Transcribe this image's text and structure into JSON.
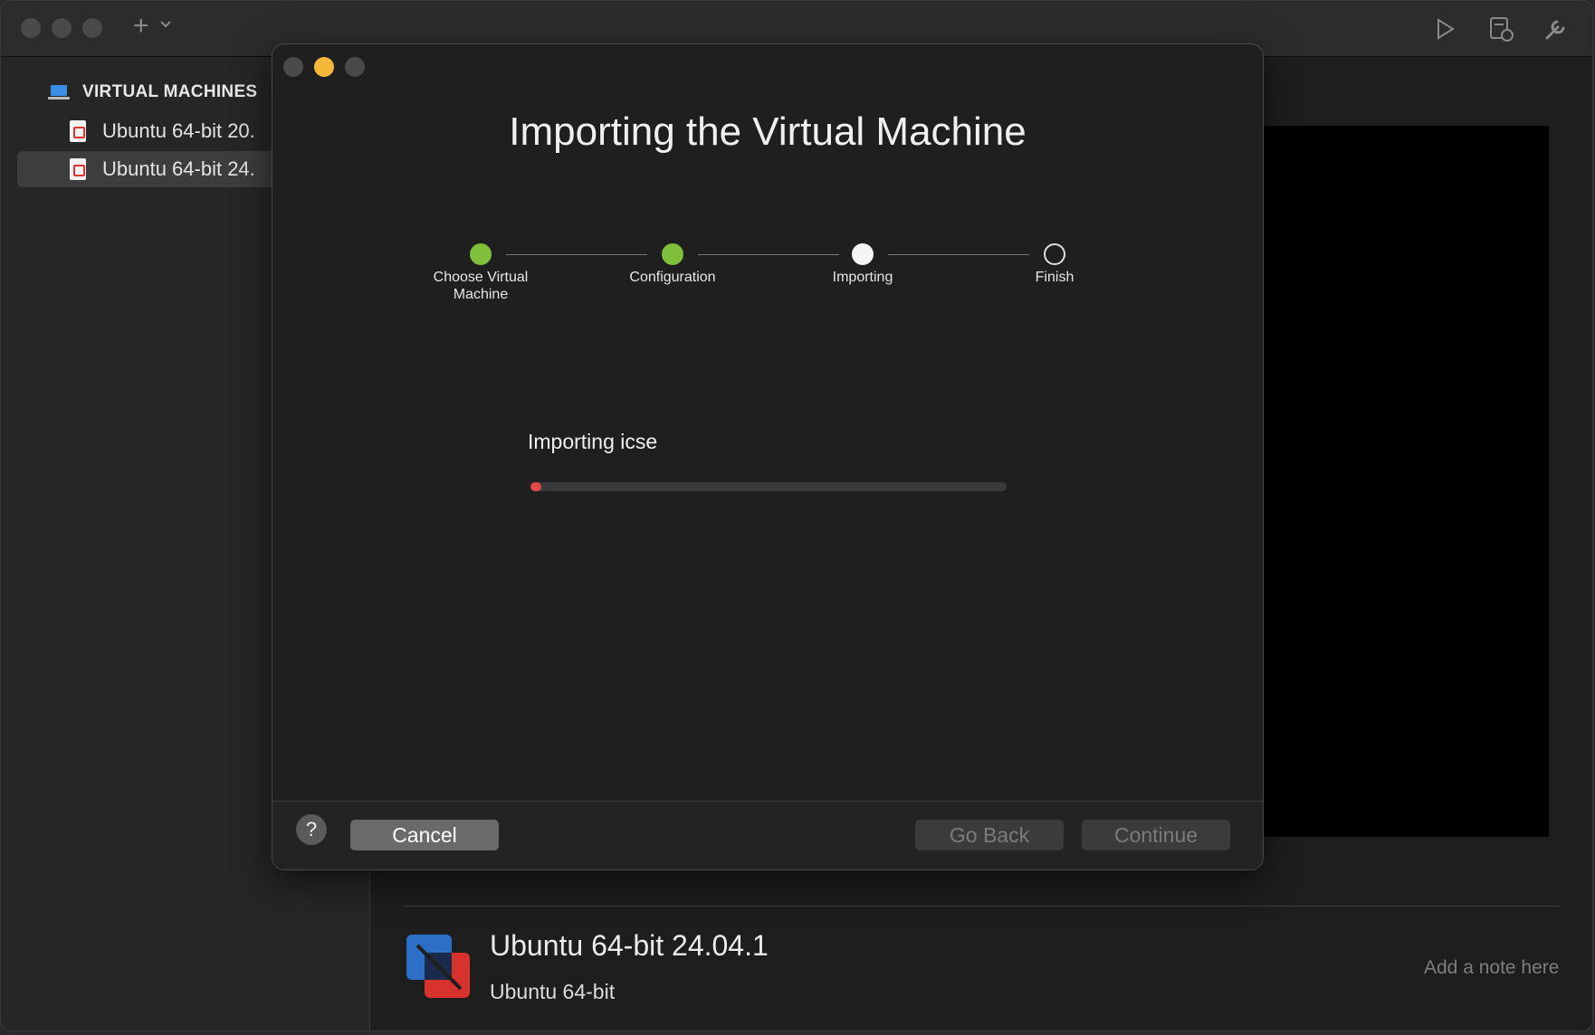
{
  "sidebar": {
    "header": "VIRTUAL MACHINES",
    "items": [
      {
        "label": "Ubuntu 64-bit 20.",
        "selected": false
      },
      {
        "label": "Ubuntu 64-bit 24.",
        "selected": true
      }
    ]
  },
  "vm_details": {
    "name": "Ubuntu 64-bit 24.04.1",
    "os": "Ubuntu 64-bit",
    "note_placeholder": "Add a note here"
  },
  "dialog": {
    "title": "Importing the Virtual Machine",
    "steps": [
      {
        "label": "Choose Virtual Machine",
        "state": "done"
      },
      {
        "label": "Configuration",
        "state": "done"
      },
      {
        "label": "Importing",
        "state": "current"
      },
      {
        "label": "Finish",
        "state": "todo"
      }
    ],
    "import_label": "Importing icse",
    "progress": 0.02,
    "help_label": "?",
    "buttons": {
      "cancel": "Cancel",
      "go_back": "Go Back",
      "continue": "Continue"
    }
  },
  "colors": {
    "step_done": "#7fbf3a",
    "progress_fill": "#e04848",
    "minimize_yellow": "#f5b83a"
  },
  "icons": [
    "add-icon",
    "chevron-down-icon",
    "play-icon",
    "snapshot-icon",
    "wrench-icon",
    "laptop-icon",
    "vm-file-icon",
    "vmware-logo-icon",
    "help-icon",
    "cursor-icon"
  ]
}
